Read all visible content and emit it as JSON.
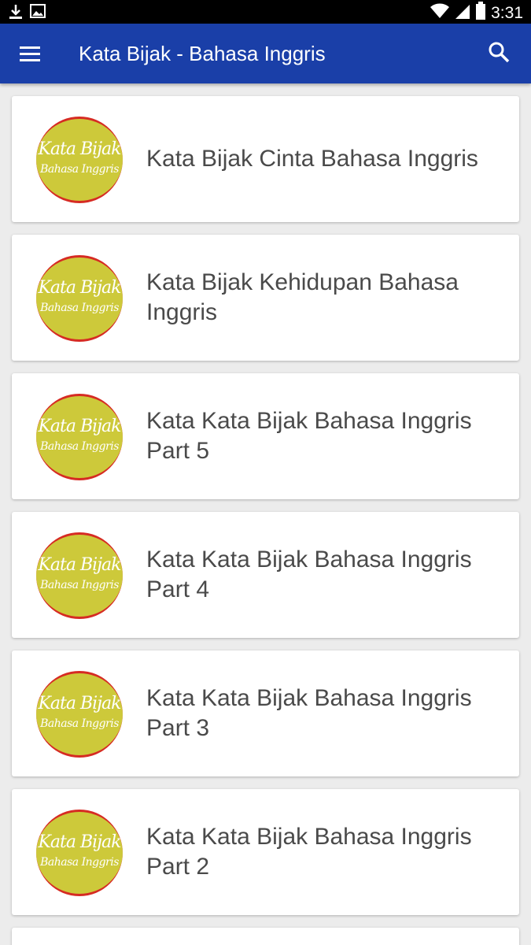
{
  "status_bar": {
    "time": "3:31"
  },
  "app_bar": {
    "title": "Kata Bijak - Bahasa Inggris"
  },
  "logo": {
    "line1": "Kata Bijak",
    "line2": "Bahasa Inggris"
  },
  "items": [
    {
      "title": "Kata Bijak Cinta Bahasa Inggris"
    },
    {
      "title": "Kata Bijak Kehidupan Bahasa Inggris"
    },
    {
      "title": "Kata Kata Bijak Bahasa Inggris Part 5"
    },
    {
      "title": "Kata Kata Bijak Bahasa Inggris Part 4"
    },
    {
      "title": "Kata Kata Bijak Bahasa Inggris Part 3"
    },
    {
      "title": "Kata Kata Bijak Bahasa Inggris Part 2"
    }
  ],
  "colors": {
    "app_bar": "#1a3fa8",
    "logo_fill": "#cdc93a",
    "logo_border": "#d62b23"
  }
}
